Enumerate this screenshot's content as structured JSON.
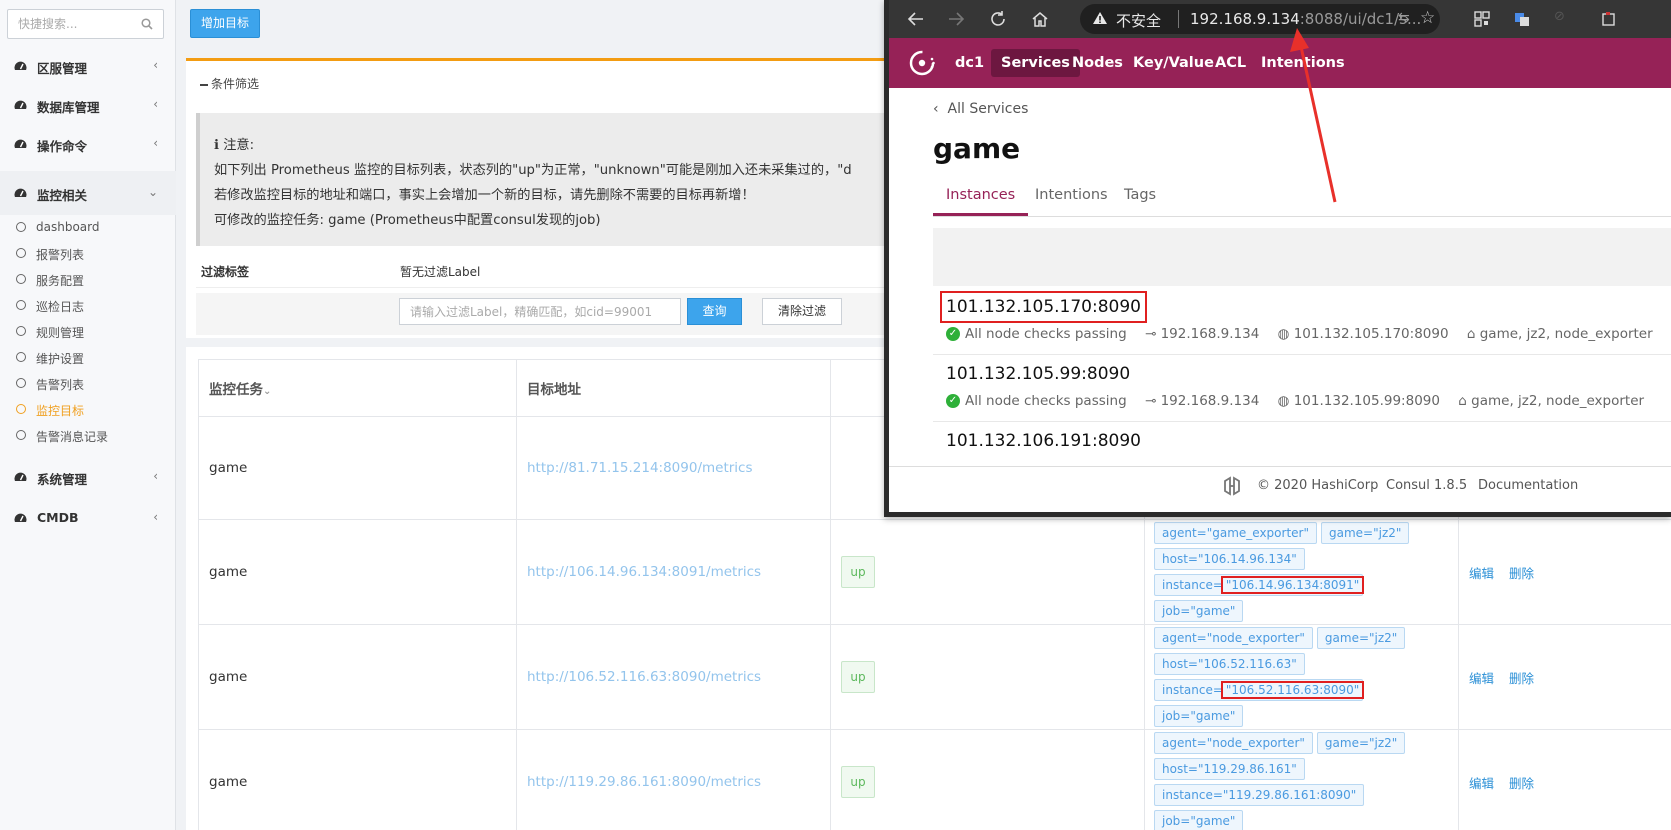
{
  "sidebar": {
    "search_placeholder": "快捷搜索...",
    "groups": [
      {
        "label": "区服管理"
      },
      {
        "label": "数据库管理"
      },
      {
        "label": "操作命令"
      },
      {
        "label": "监控相关"
      },
      {
        "label": "系统管理"
      },
      {
        "label": "CMDB"
      }
    ],
    "monitor_items": [
      {
        "label": "dashboard"
      },
      {
        "label": "报警列表"
      },
      {
        "label": "服务配置"
      },
      {
        "label": "巡检日志"
      },
      {
        "label": "规则管理"
      },
      {
        "label": "维护设置"
      },
      {
        "label": "告警列表"
      },
      {
        "label": "监控目标"
      },
      {
        "label": "告警消息记录"
      }
    ],
    "active_color": "#f0a020"
  },
  "toolbar": {
    "add_label": "增加目标"
  },
  "filter": {
    "title": "条件筛选",
    "notice_title": "注意:",
    "notice_lines": [
      "如下列出 Prometheus 监控的目标列表，状态列的\"up\"为正常，\"unknown\"可能是刚加入还未采集过的，\"d",
      "若修改监控目标的地址和端口，事实上会增加一个新的目标，请先删除不需要的目标再新增！",
      "可修改的监控任务: game (Prometheus中配置consul发现的job)"
    ],
    "label_title": "过滤标签",
    "no_label": "暂无过滤Label",
    "input_placeholder": "请输入过滤Label，精确匹配，如cid=99001",
    "query_label": "查询",
    "clear_label": "清除过滤"
  },
  "table": {
    "headers": [
      "监控任务",
      "目标地址",
      "",
      "",
      ""
    ],
    "rows": [
      {
        "job": "game",
        "url": "http://81.71.15.214:8090/metrics",
        "status": "",
        "labels": [],
        "edit": "",
        "del": ""
      },
      {
        "job": "game",
        "url": "http://106.14.96.134:8091/metrics",
        "status": "up",
        "labels": [
          "agent=\"game_exporter\"",
          "game=\"jz2\"",
          "host=\"106.14.96.134\"",
          "instance=\"106.14.96.134:8091\"",
          "job=\"game\""
        ],
        "edit": "编辑",
        "del": "删除"
      },
      {
        "job": "game",
        "url": "http://106.52.116.63:8090/metrics",
        "status": "up",
        "labels": [
          "agent=\"node_exporter\"",
          "game=\"jz2\"",
          "host=\"106.52.116.63\"",
          "instance=\"106.52.116.63:8090\"",
          "job=\"game\""
        ],
        "edit": "编辑",
        "del": "删除"
      },
      {
        "job": "game",
        "url": "http://119.29.86.161:8090/metrics",
        "status": "up",
        "labels": [
          "agent=\"node_exporter\"",
          "game=\"jz2\"",
          "host=\"119.29.86.161\"",
          "instance=\"119.29.86.161:8090\"",
          "job=\"game\""
        ],
        "edit": "编辑",
        "del": "删除"
      }
    ]
  },
  "browser": {
    "insecure": "不安全",
    "url_host": "192.168.9.134",
    "url_rest": ":8088/ui/dc1/s...",
    "nav": [
      "dc1",
      "Services",
      "Nodes",
      "Key/Value",
      "ACL",
      "Intentions"
    ],
    "back_label": "All Services",
    "service_title": "game",
    "tabs": [
      "Instances",
      "Intentions",
      "Tags"
    ],
    "instances": [
      {
        "addr": "101.132.105.170:8090",
        "check": "All node checks passing",
        "node": "192.168.9.134",
        "address": "101.132.105.170:8090",
        "tags": "game, jz2, node_exporter"
      },
      {
        "addr": "101.132.105.99:8090",
        "check": "All node checks passing",
        "node": "192.168.9.134",
        "address": "101.132.105.99:8090",
        "tags": "game, jz2, node_exporter"
      },
      {
        "addr": "101.132.106.191:8090",
        "check": "",
        "node": "",
        "address": "",
        "tags": ""
      }
    ],
    "footer": {
      "copyright": "© 2020 HashiCorp",
      "version": "Consul 1.8.5",
      "docs": "Documentation"
    },
    "brand_color": "#962257"
  }
}
